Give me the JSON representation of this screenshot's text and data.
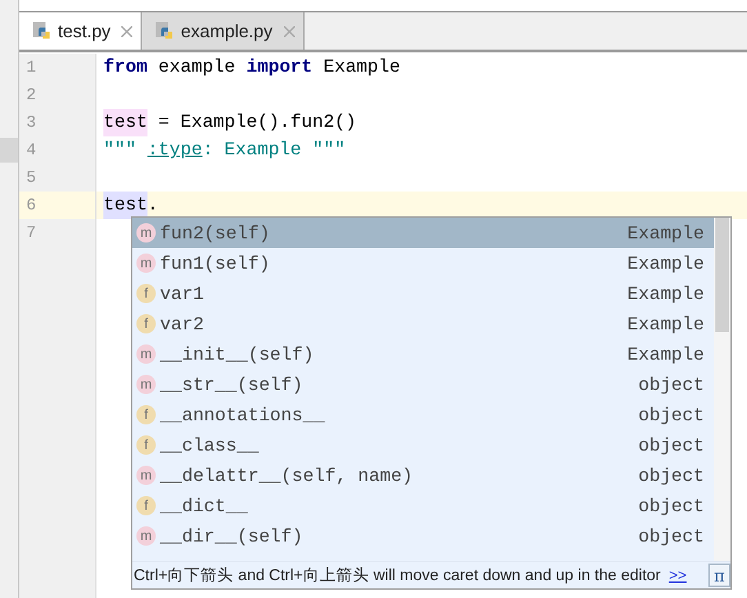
{
  "tabs": [
    {
      "label": "test.py",
      "selected": true
    },
    {
      "label": "example.py",
      "selected": false
    }
  ],
  "editor": {
    "lines": [
      {
        "number": "1",
        "current": false,
        "segments": [
          {
            "text": "from",
            "kind": "keyword"
          },
          {
            "text": " example ",
            "kind": "plain"
          },
          {
            "text": "import",
            "kind": "keyword"
          },
          {
            "text": " Example",
            "kind": "plain"
          }
        ]
      },
      {
        "number": "2",
        "current": false
      },
      {
        "number": "3",
        "current": false,
        "segments": [
          {
            "text": "test",
            "kind": "usage"
          },
          {
            "text": " = Example().fun2()",
            "kind": "plain"
          }
        ]
      },
      {
        "number": "4",
        "current": false,
        "segments": [
          {
            "text": "\"\"\" ",
            "kind": "doc"
          },
          {
            "text": ":type",
            "kind": "doctag"
          },
          {
            "text": ": Example \"\"\"",
            "kind": "doc"
          }
        ]
      },
      {
        "number": "5",
        "current": false
      },
      {
        "number": "6",
        "current": true,
        "segments": [
          {
            "text": "test",
            "kind": "ref"
          },
          {
            "text": ".",
            "kind": "plain"
          }
        ]
      },
      {
        "number": "7",
        "current": false
      }
    ]
  },
  "completion": {
    "items": [
      {
        "kind": "method",
        "icon": "m",
        "name": "fun2(self)",
        "type": "Example",
        "selected": true
      },
      {
        "kind": "method",
        "icon": "m",
        "name": "fun1(self)",
        "type": "Example",
        "selected": false
      },
      {
        "kind": "field",
        "icon": "f",
        "name": "var1",
        "type": "Example",
        "selected": false
      },
      {
        "kind": "field",
        "icon": "f",
        "name": "var2",
        "type": "Example",
        "selected": false
      },
      {
        "kind": "method",
        "icon": "m",
        "name": "__init__(self)",
        "type": "Example",
        "selected": false
      },
      {
        "kind": "method",
        "icon": "m",
        "name": "__str__(self)",
        "type": "object",
        "selected": false
      },
      {
        "kind": "field",
        "icon": "f",
        "name": "__annotations__",
        "type": "object",
        "selected": false
      },
      {
        "kind": "field",
        "icon": "f",
        "name": "__class__",
        "type": "object",
        "selected": false
      },
      {
        "kind": "method",
        "icon": "m",
        "name": "__delattr__(self, name)",
        "type": "object",
        "selected": false
      },
      {
        "kind": "field",
        "icon": "f",
        "name": "__dict__",
        "type": "object",
        "selected": false
      },
      {
        "kind": "method",
        "icon": "m",
        "name": "__dir__(self)",
        "type": "object",
        "selected": false
      }
    ],
    "hint": "Ctrl+向下箭头 and Ctrl+向上箭头 will move caret down and up in the editor",
    "hint_link": ">>",
    "pi_button": "π"
  }
}
